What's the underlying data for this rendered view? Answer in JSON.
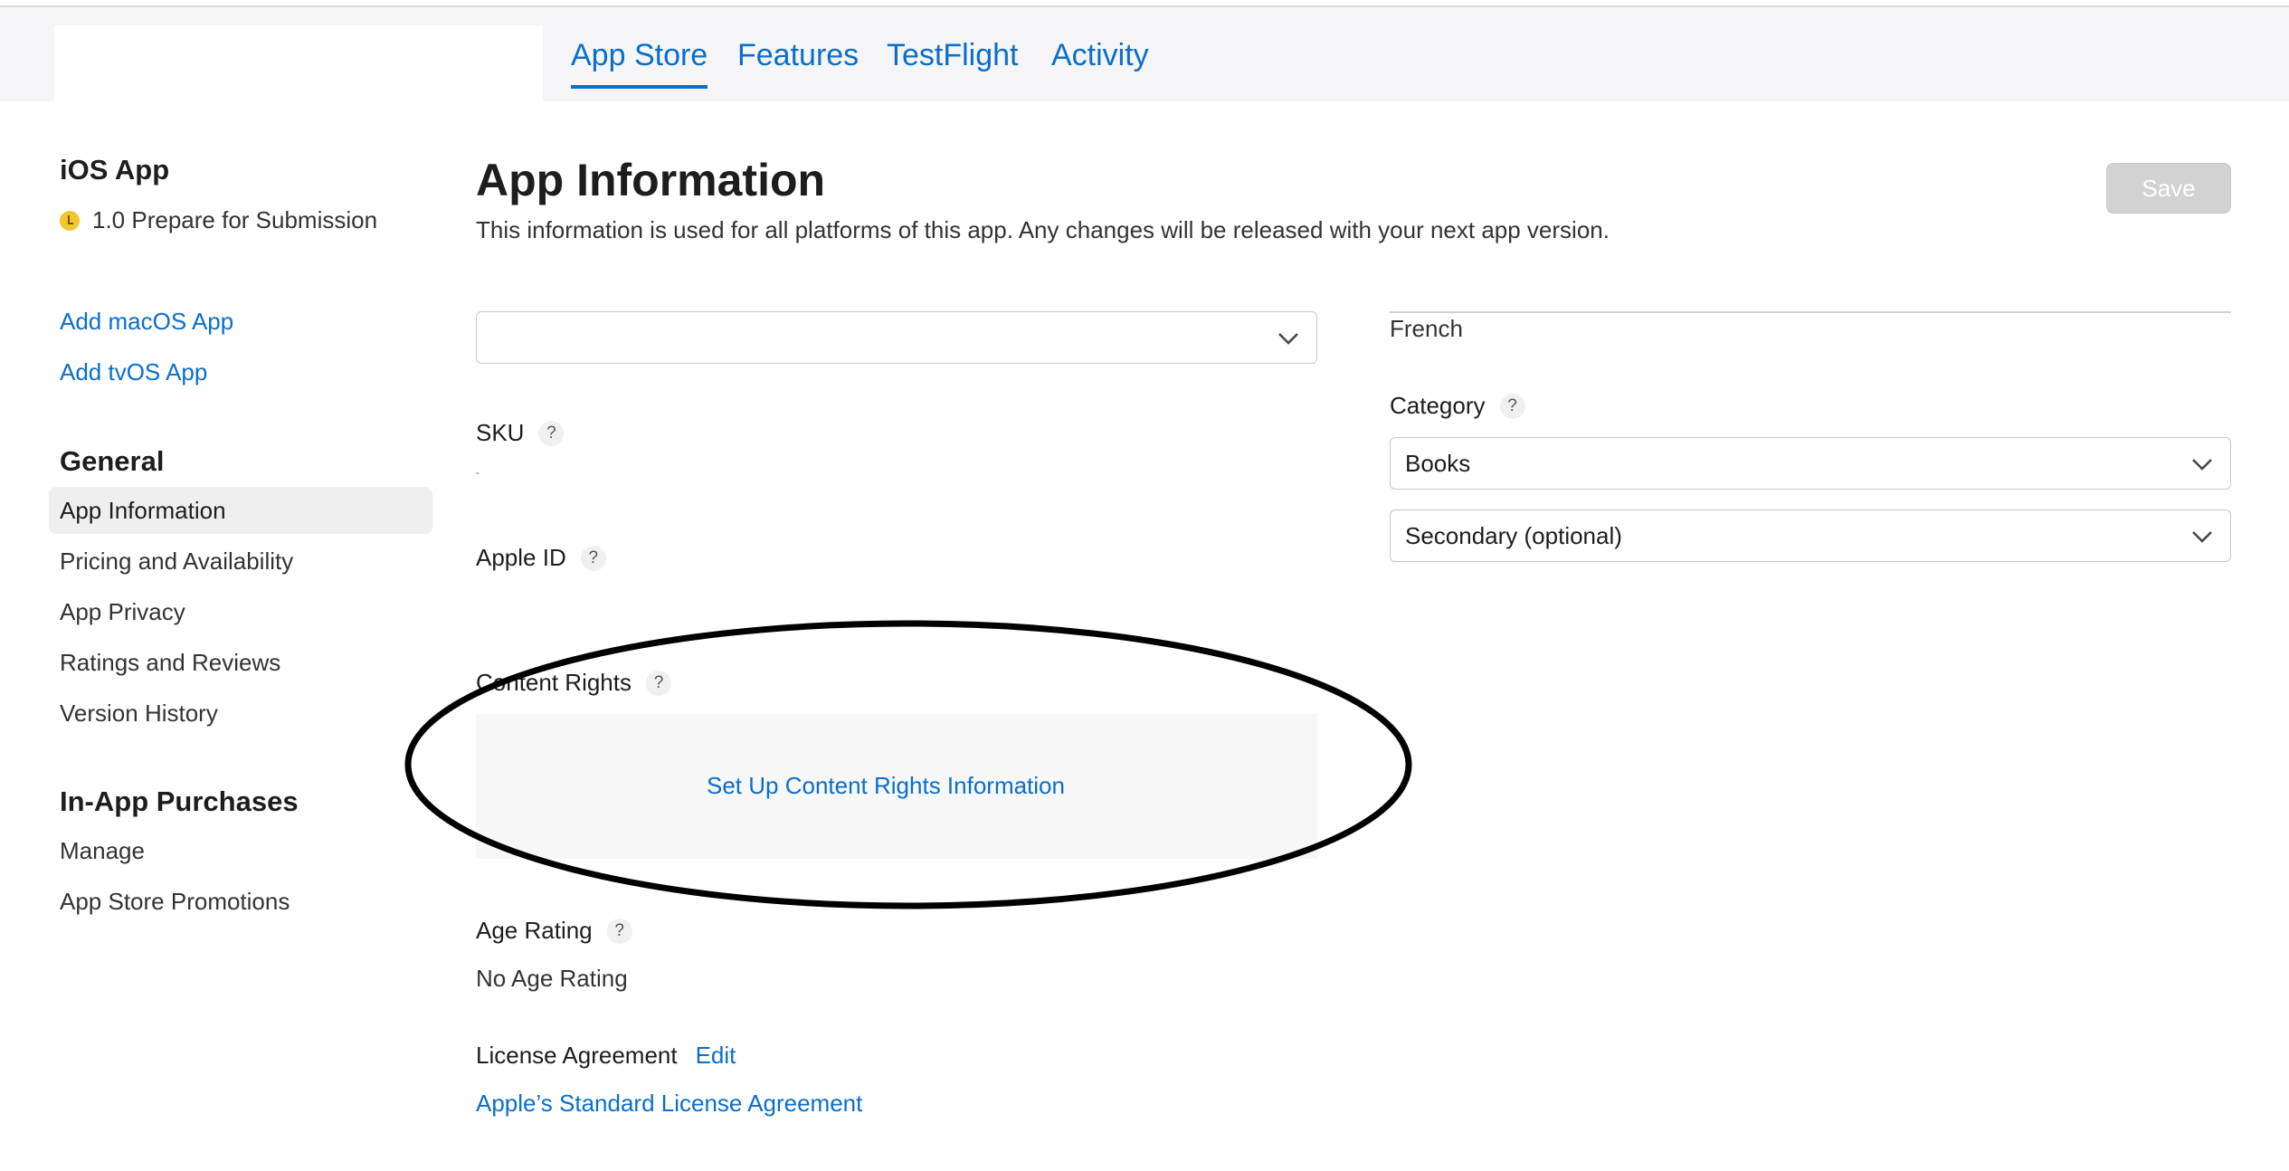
{
  "tabs": [
    {
      "label": "App Store",
      "active": true
    },
    {
      "label": "Features",
      "active": false
    },
    {
      "label": "TestFlight",
      "active": false
    },
    {
      "label": "Activity",
      "active": false
    }
  ],
  "sidebar": {
    "platform_title": "iOS App",
    "version_status": "1.0 Prepare for Submission",
    "add_links": [
      "Add macOS App",
      "Add tvOS App"
    ],
    "general_heading": "General",
    "general_items": [
      "App Information",
      "Pricing and Availability",
      "App Privacy",
      "Ratings and Reviews",
      "Version History"
    ],
    "iap_heading": "In-App Purchases",
    "iap_items": [
      "Manage",
      "App Store Promotions"
    ]
  },
  "main": {
    "title": "App Information",
    "subtitle": "This information is used for all platforms of this app. Any changes will be released with your next app version.",
    "save_label": "Save",
    "top_select_value": "",
    "sku_label": "SKU",
    "apple_id_label": "Apple ID",
    "content_rights_label": "Content Rights",
    "content_rights_link": "Set Up Content Rights Information",
    "age_rating_label": "Age Rating",
    "age_rating_value": "No Age Rating",
    "license_label": "License Agreement",
    "license_edit": "Edit",
    "license_link": "Apple’s Standard License Agreement",
    "help_glyph": "?"
  },
  "right": {
    "primary_language": "French",
    "category_label": "Category",
    "primary_category": "Books",
    "secondary_category": "Secondary (optional)"
  },
  "colors": {
    "accent": "#0a6ecb",
    "status_pending": "#f2c531",
    "save_disabled": "#d2d2d2",
    "annotation": "#000000"
  },
  "icons": [
    "chevron-down-icon",
    "help-icon",
    "clock-status-icon"
  ]
}
